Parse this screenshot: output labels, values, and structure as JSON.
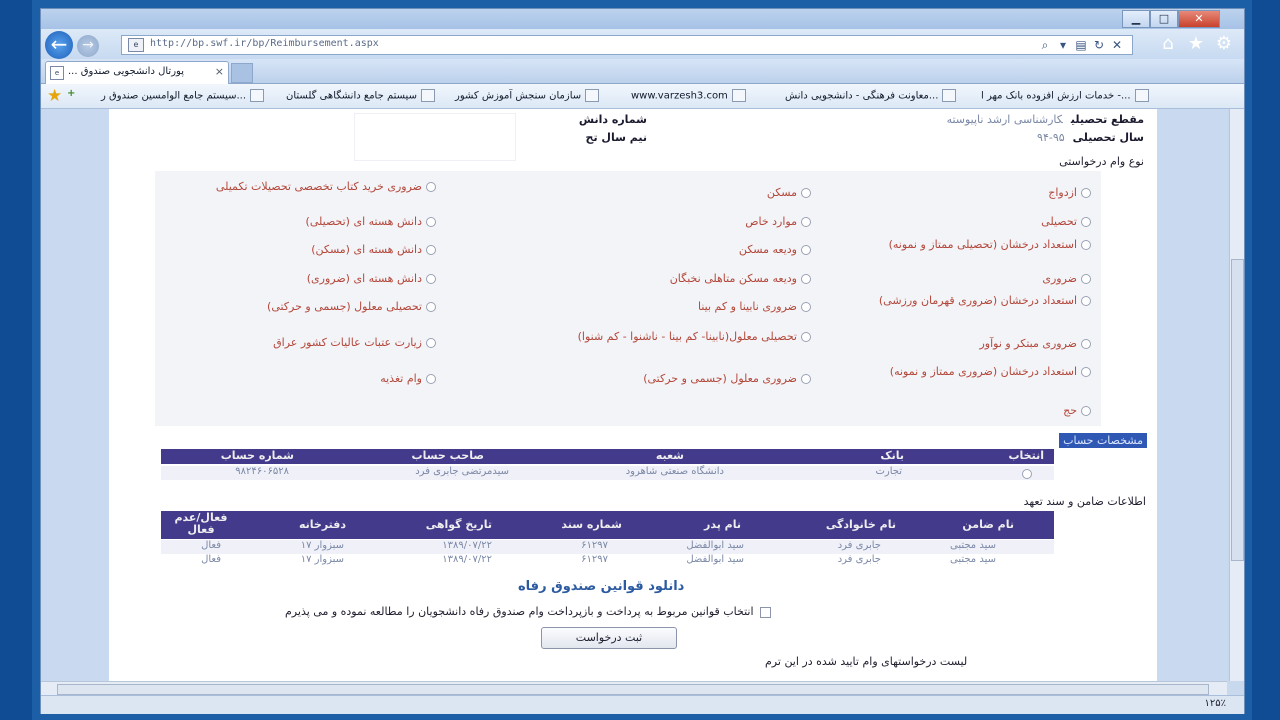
{
  "browser": {
    "url": "http://bp.swf.ir/bp/Reimbursement.aspx",
    "tab_title": "... پورتال دانشجویی صندوق",
    "tab_close": "×",
    "caption_min": "▁",
    "caption_max": "□",
    "caption_close": "✕",
    "favorites": [
      "خدمات ارزش افزوده بانک مهر ا -...",
      "معاونت فرهنگی - دانشجویی دانش...",
      "www.varzesh3.com",
      "سازمان سنجش آموزش کشور",
      "سیستم جامع دانشگاهی گلستان",
      "سیستم جامع الوامسین صندوق ر..."
    ],
    "zoom": "۱۲۵٪"
  },
  "header": {
    "degree_label": "مقطع تحصیلی",
    "degree_value": "کارشناسی ارشد ناپیوسته",
    "year_label": "سال تحصیلی",
    "year_value": "۹۵-۹۴",
    "student_no_label": "شماره دانش",
    "semester_label": "نیم سال تح"
  },
  "loan_types": {
    "title": "نوع وام درخواستی",
    "col1": [
      "ازدواج",
      "تحصیلی",
      "استعداد درخشان (تحصیلی ممتاز و نمونه)",
      "ضروری",
      "استعداد درخشان (ضروری قهرمان ورزشی)",
      "ضروری مبتکر و نوآور",
      "استعداد درخشان (ضروری ممتاز و نمونه)",
      "حج"
    ],
    "col2": [
      "مسکن",
      "موارد خاص",
      "ودیعه مسکن",
      "ودیعه مسکن متاهلی نخبگان",
      "ضروری نابینا و کم بینا",
      "تحصیلی معلول(نابینا- کم بینا - ناشنوا - کم شنوا)",
      "ضروری معلول (جسمی و حرکتی)"
    ],
    "col3": [
      "ضروری خرید کتاب تخصصی تحصیلات تکمیلی",
      "دانش هسته ای (تحصیلی)",
      "دانش هسته ای (مسکن)",
      "دانش هسته ای (ضروری)",
      "تحصیلی معلول (جسمی و حرکتی)",
      "زیارت عتبات عالیات کشور عراق",
      "وام تغذیه"
    ]
  },
  "accounts": {
    "title": "مشخصات حساب",
    "headers": [
      "انتخاب",
      "بانک",
      "شعبه",
      "صاحب حساب",
      "شماره حساب"
    ],
    "rows": [
      {
        "bank": "تجارت",
        "branch": "دانشگاه صنعتی شاهرود",
        "owner": "سیدمرتضی جابری فرد",
        "number": "۹۸۲۴۶۰۶۵۲۸"
      }
    ]
  },
  "guarantee": {
    "title": "اطلاعات ضامن و سند تعهد",
    "headers": [
      "نام ضامن",
      "نام خانوادگی",
      "نام پدر",
      "شماره سند",
      "تاریخ گواهی",
      "دفترخانه",
      "فعال/عدم فعال"
    ],
    "rows": [
      {
        "name": "سید مجتبی",
        "family": "جابری فرد",
        "father": "سید ابوالفضل",
        "doc": "۶۱۲۹۷",
        "date": "۱۳۸۹/۰۷/۲۲",
        "office": "سبزوار ۱۷",
        "status": "فعال"
      },
      {
        "name": "سید مجتبی",
        "family": "جابری فرد",
        "father": "سید ابوالفضل",
        "doc": "۶۱۲۹۷",
        "date": "۱۳۸۹/۰۷/۲۲",
        "office": "سبزوار ۱۷",
        "status": "فعال"
      }
    ]
  },
  "download_link": "دانلود قوانین صندوق رفاه",
  "agree_text": "انتخاب قوانین مربوط به پرداخت و بازپرداخت وام صندوق رفاه دانشجویان را مطالعه نموده و می پذیرم",
  "submit_label": "ثبت درخواست",
  "approved_list_title": "لیست درخواستهای وام تایید شده در این ترم"
}
